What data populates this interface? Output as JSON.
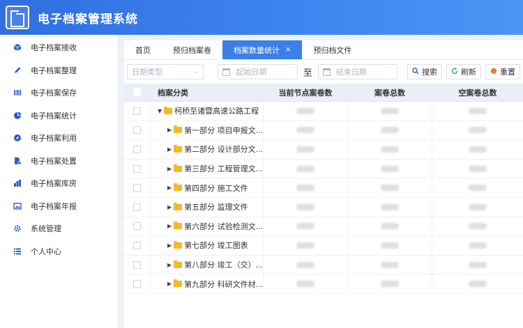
{
  "app": {
    "title": "电子档案管理系统"
  },
  "sidebar": {
    "items": [
      {
        "label": "电子档案接收",
        "icon": "cube-icon"
      },
      {
        "label": "电子档案整理",
        "icon": "pencil-icon"
      },
      {
        "label": "电子档案保存",
        "icon": "barcode-icon"
      },
      {
        "label": "电子档案统计",
        "icon": "pie-chart-icon"
      },
      {
        "label": "电子档案利用",
        "icon": "compass-icon"
      },
      {
        "label": "电子档案处置",
        "icon": "document-settings-icon"
      },
      {
        "label": "电子档案库房",
        "icon": "bar-chart-icon"
      },
      {
        "label": "电子档案年报",
        "icon": "image-report-icon"
      },
      {
        "label": "系统管理",
        "icon": "gear-icon"
      },
      {
        "label": "个人中心",
        "icon": "list-icon"
      }
    ]
  },
  "tabs": [
    {
      "label": "首页",
      "active": false
    },
    {
      "label": "预归档案卷",
      "active": false
    },
    {
      "label": "档案数量统计",
      "active": true,
      "close": "×"
    },
    {
      "label": "预归档文件",
      "active": false
    }
  ],
  "filters": {
    "date_type_placeholder": "日期类型",
    "start_date_placeholder": "起始日期",
    "to_label": "至",
    "end_date_placeholder": "结束日期"
  },
  "buttons": {
    "search": "搜索",
    "refresh": "刷新",
    "reset": "重置"
  },
  "table": {
    "columns": [
      "档案分类",
      "当前节点案卷数",
      "案卷总数",
      "空案卷总数"
    ],
    "rows": [
      {
        "label": "柯桥至诸暨高速公路工程",
        "level": 0,
        "expanded": true
      },
      {
        "label": "第一部分 项目申报文...",
        "level": 1
      },
      {
        "label": "第二部分 设计部分文...",
        "level": 1
      },
      {
        "label": "第三部分 工程管理文...",
        "level": 1
      },
      {
        "label": "第四部分 施工文件",
        "level": 1
      },
      {
        "label": "第五部分 监理文件",
        "level": 1
      },
      {
        "label": "第六部分 试验检测文...",
        "level": 1
      },
      {
        "label": "第七部分 竣工图表",
        "level": 1
      },
      {
        "label": "第八部分 竣工（交）...",
        "level": 1
      },
      {
        "label": "第九部分 科研文件材...",
        "level": 1
      }
    ]
  },
  "colors": {
    "header_start": "#2f6fe0",
    "header_end": "#4c95f5",
    "active_tab": "#3a80e8",
    "folder": "#f6b72b",
    "table_header": "#e9eef7"
  }
}
